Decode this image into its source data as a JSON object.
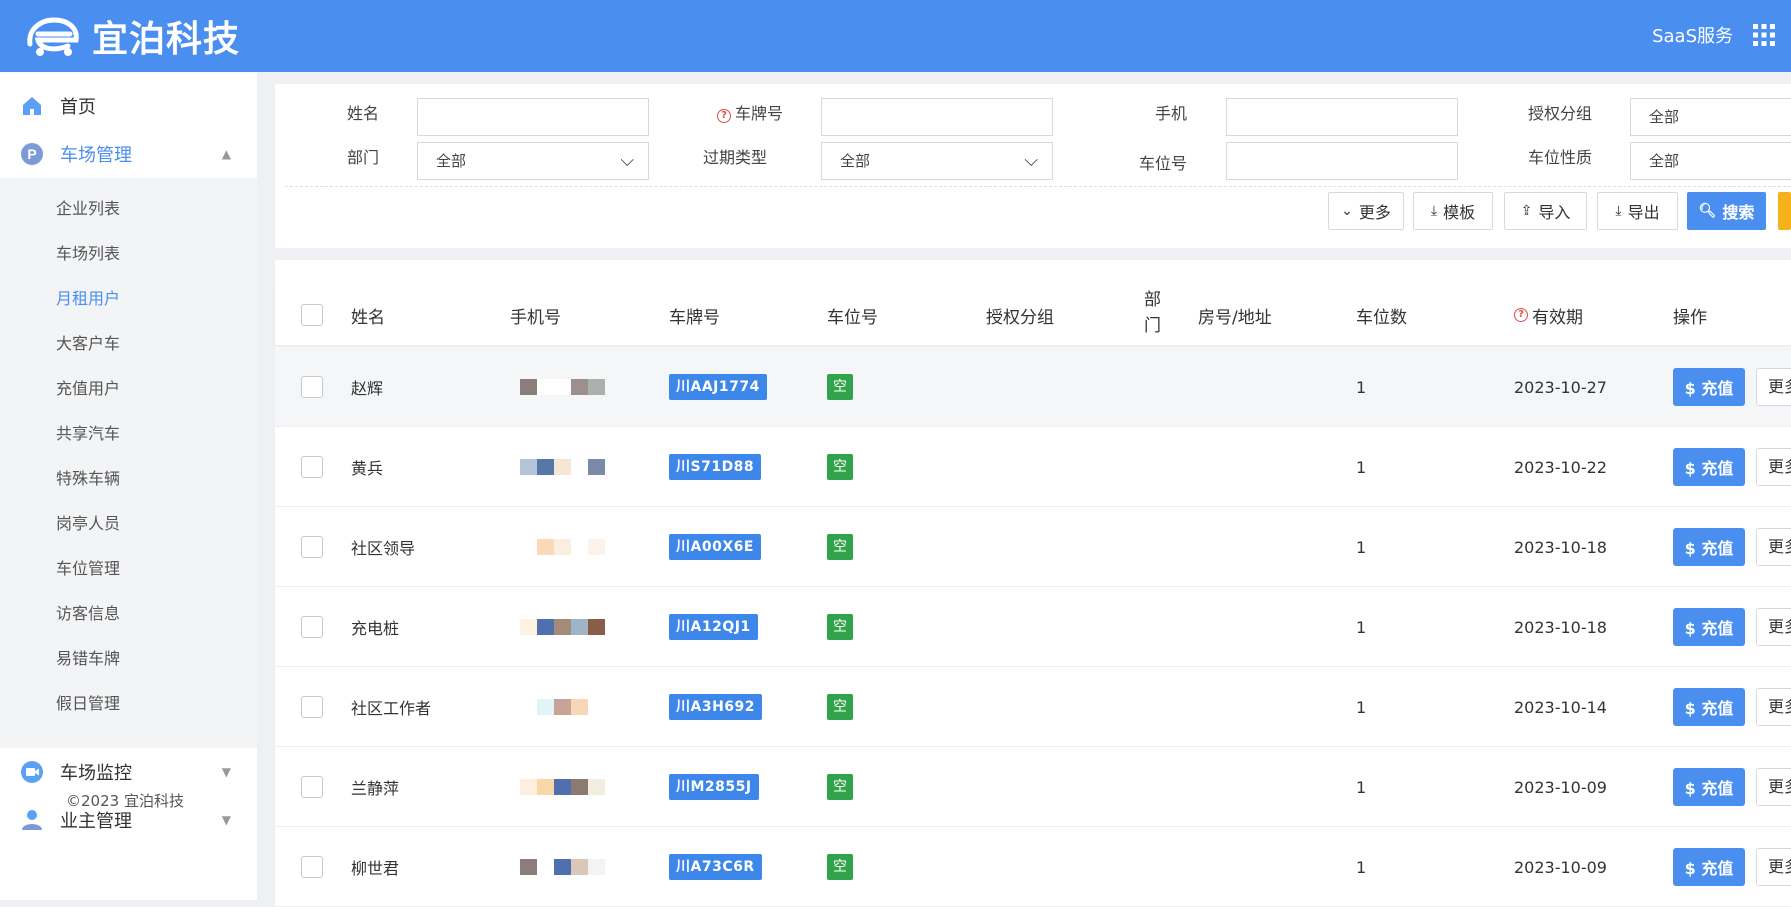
{
  "header": {
    "brand": "宜泊科技",
    "saas_label": "SaaS服务"
  },
  "sidebar": {
    "home": "首页",
    "parking_mgmt": "车场管理",
    "sub_items": [
      "企业列表",
      "车场列表",
      "月租用户",
      "大客户车",
      "充值用户",
      "共享汽车",
      "特殊车辆",
      "岗亭人员",
      "车位管理",
      "访客信息",
      "易错车牌",
      "假日管理"
    ],
    "active_sub": "月租用户",
    "monitor": "车场监控",
    "owner_mgmt": "业主管理",
    "copyright": "©2023 宜泊科技"
  },
  "filters": {
    "name_label": "姓名",
    "plate_label": "车牌号",
    "phone_label": "手机",
    "auth_group_label": "授权分组",
    "auth_group_value": "全部",
    "dept_label": "部门",
    "dept_value": "全部",
    "expire_label": "过期类型",
    "expire_value": "全部",
    "space_no_label": "车位号",
    "space_nature_label": "车位性质",
    "space_nature_value": "全部",
    "buttons": {
      "more": "更多",
      "template": "模板",
      "import": "导入",
      "export": "导出",
      "search": "搜索"
    }
  },
  "table": {
    "columns": {
      "name": "姓名",
      "phone": "手机号",
      "plate": "车牌号",
      "space": "车位号",
      "auth": "授权分组",
      "dept_top": "部",
      "dept_bottom": "门",
      "room": "房号/地址",
      "count": "车位数",
      "validity": "有效期",
      "action": "操作"
    },
    "charge_label": "$ 充值",
    "more_label": "更多",
    "rows": [
      {
        "name": "赵辉",
        "plate": "川AAJ1774",
        "space": "空",
        "count": "1",
        "validity": "2023-10-27"
      },
      {
        "name": "黄兵",
        "plate": "川S71D88",
        "space": "空",
        "count": "1",
        "validity": "2023-10-22"
      },
      {
        "name": "社区领导",
        "plate": "川A00X6E",
        "space": "空",
        "count": "1",
        "validity": "2023-10-18"
      },
      {
        "name": "充电桩",
        "plate": "川A12QJ1",
        "space": "空",
        "count": "1",
        "validity": "2023-10-18"
      },
      {
        "name": "社区工作者",
        "plate": "川A3H692",
        "space": "空",
        "count": "1",
        "validity": "2023-10-14"
      },
      {
        "name": "兰静萍",
        "plate": "川M2855J",
        "space": "空",
        "count": "1",
        "validity": "2023-10-09"
      },
      {
        "name": "柳世君",
        "plate": "川A73C6R",
        "space": "空",
        "count": "1",
        "validity": "2023-10-09"
      }
    ]
  },
  "colors": {
    "primary": "#4a8ef0",
    "success": "#31a34a",
    "warning": "#f7b21b",
    "danger": "#e34b4b"
  },
  "icons": [
    "car-e-logo",
    "apps-grid-icon",
    "home-icon",
    "parking-icon",
    "camera-icon",
    "user-icon",
    "help-icon",
    "chevron-down-icon",
    "download-icon",
    "upload-icon",
    "search-icon"
  ]
}
